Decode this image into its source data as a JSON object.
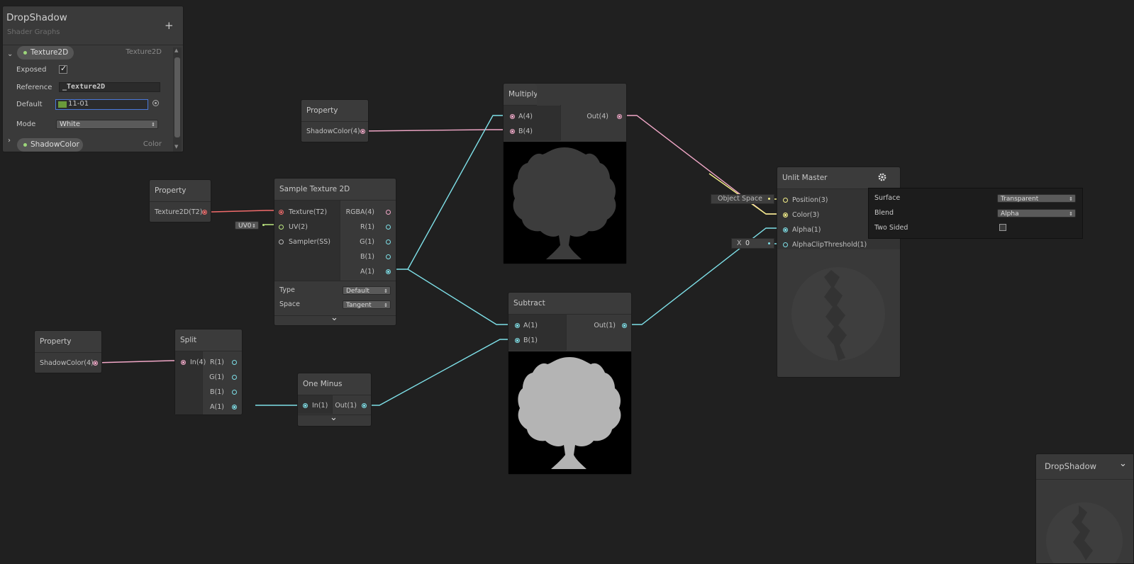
{
  "blackboard": {
    "title": "DropShadow",
    "subtitle": "Shader Graphs",
    "add_label": "+",
    "properties": [
      {
        "name": "Texture2D",
        "type": "Texture2D",
        "expanded": true,
        "fields": {
          "exposed_label": "Exposed",
          "exposed": true,
          "reference_label": "Reference",
          "reference_value": "_Texture2D",
          "default_label": "Default",
          "default_value": "11-01",
          "mode_label": "Mode",
          "mode_value": "White"
        }
      },
      {
        "name": "ShadowColor",
        "type": "Color",
        "expanded": false
      }
    ]
  },
  "nodes": {
    "prop_shadow_top": {
      "title": "Property",
      "out": "ShadowColor(4)"
    },
    "prop_tex": {
      "title": "Property",
      "out": "Texture2D(T2)"
    },
    "prop_shadow_bottom": {
      "title": "Property",
      "out": "ShadowColor(4)"
    },
    "sample": {
      "title": "Sample Texture 2D",
      "inputs": [
        "Texture(T2)",
        "UV(2)",
        "Sampler(SS)"
      ],
      "outputs": [
        "RGBA(4)",
        "R(1)",
        "G(1)",
        "B(1)",
        "A(1)"
      ],
      "uv_value": "UV0",
      "type_label": "Type",
      "type_value": "Default",
      "space_label": "Space",
      "space_value": "Tangent",
      "expand": "⌄"
    },
    "split": {
      "title": "Split",
      "inputs": [
        "In(4)"
      ],
      "outputs": [
        "R(1)",
        "G(1)",
        "B(1)",
        "A(1)"
      ]
    },
    "oneminus": {
      "title": "One Minus",
      "inputs": [
        "In(1)"
      ],
      "outputs": [
        "Out(1)"
      ],
      "expand": "⌄"
    },
    "multiply": {
      "title": "Multiply",
      "inputs": [
        "A(4)",
        "B(4)"
      ],
      "outputs": [
        "Out(4)"
      ]
    },
    "subtract": {
      "title": "Subtract",
      "inputs": [
        "A(1)",
        "B(1)"
      ],
      "outputs": [
        "Out(1)"
      ]
    },
    "master": {
      "title": "Unlit Master",
      "inputs": [
        "Position(3)",
        "Color(3)",
        "Alpha(1)",
        "AlphaClipThreshold(1)"
      ],
      "position_space": "Object Space",
      "clip_axis": "X",
      "clip_value": "0"
    }
  },
  "settings_popup": {
    "surface_label": "Surface",
    "surface_value": "Transparent",
    "blend_label": "Blend",
    "blend_value": "Alpha",
    "two_sided_label": "Two Sided",
    "two_sided": false
  },
  "preview": {
    "title": "DropShadow",
    "collapse": "⌄"
  },
  "colors": {
    "background": "#202020",
    "node": "#393939",
    "dynamic_vector": "#f2a8c8",
    "float": "#7ee0e8",
    "texture": "#f16b6b",
    "vector3": "#f5f08a",
    "vector2": "#bde880"
  }
}
